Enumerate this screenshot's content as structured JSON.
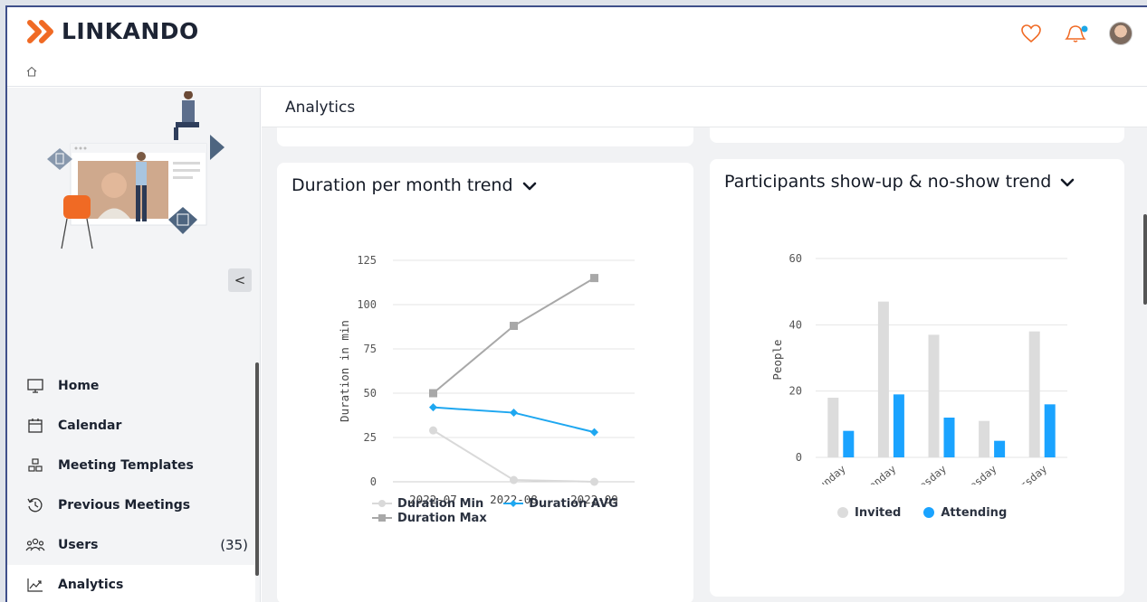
{
  "app": {
    "brand": "LINKANDO",
    "brand_color": "#f06a24"
  },
  "topbar": {
    "icons": [
      "heart-icon",
      "bell-icon",
      "avatar"
    ],
    "notification_dot_color": "#1ea7e6"
  },
  "sidebar": {
    "collapse_label": "<",
    "items": [
      {
        "label": "Home",
        "icon": "monitor-icon",
        "count": ""
      },
      {
        "label": "Calendar",
        "icon": "calendar-icon",
        "count": ""
      },
      {
        "label": "Meeting Templates",
        "icon": "templates-icon",
        "count": ""
      },
      {
        "label": "Previous Meetings",
        "icon": "history-icon",
        "count": ""
      },
      {
        "label": "Users",
        "icon": "users-icon",
        "count": "(35)"
      },
      {
        "label": "Analytics",
        "icon": "analytics-icon",
        "count": "",
        "active": true
      }
    ]
  },
  "main": {
    "title": "Analytics"
  },
  "cards": {
    "duration": {
      "title": "Duration per month trend"
    },
    "participants": {
      "title": "Participants show-up & no-show trend"
    }
  },
  "chart_data": [
    {
      "type": "line",
      "title": "Duration per month trend",
      "xlabel": "",
      "ylabel": "Duration in min",
      "categories": [
        "2022-07",
        "2022-08",
        "2022-09"
      ],
      "ylim": [
        0,
        125
      ],
      "yticks": [
        0,
        25,
        50,
        75,
        100,
        125
      ],
      "series": [
        {
          "name": "Duration Min",
          "values": [
            29,
            1,
            0
          ],
          "color": "#d9d9d9",
          "marker": "circle"
        },
        {
          "name": "Duration AVG",
          "values": [
            42,
            39,
            28
          ],
          "color": "#1ea7f0",
          "marker": "diamond"
        },
        {
          "name": "Duration Max",
          "values": [
            50,
            88,
            115
          ],
          "color": "#a8a8a8",
          "marker": "square"
        }
      ],
      "legend_position": "bottom"
    },
    {
      "type": "bar",
      "title": "Participants show-up & no-show trend",
      "xlabel": "",
      "ylabel": "People",
      "categories": [
        "Sunday",
        "Monday",
        "Tuesday",
        "Wednesday",
        "Thursday"
      ],
      "ylim": [
        0,
        60
      ],
      "yticks": [
        0,
        20,
        40,
        60
      ],
      "series": [
        {
          "name": "Invited",
          "values": [
            18,
            47,
            37,
            11,
            38
          ],
          "color": "#dcdcdc"
        },
        {
          "name": "Attending",
          "values": [
            8,
            19,
            12,
            5,
            16
          ],
          "color": "#1aa3ff"
        }
      ],
      "legend_position": "bottom"
    }
  ]
}
